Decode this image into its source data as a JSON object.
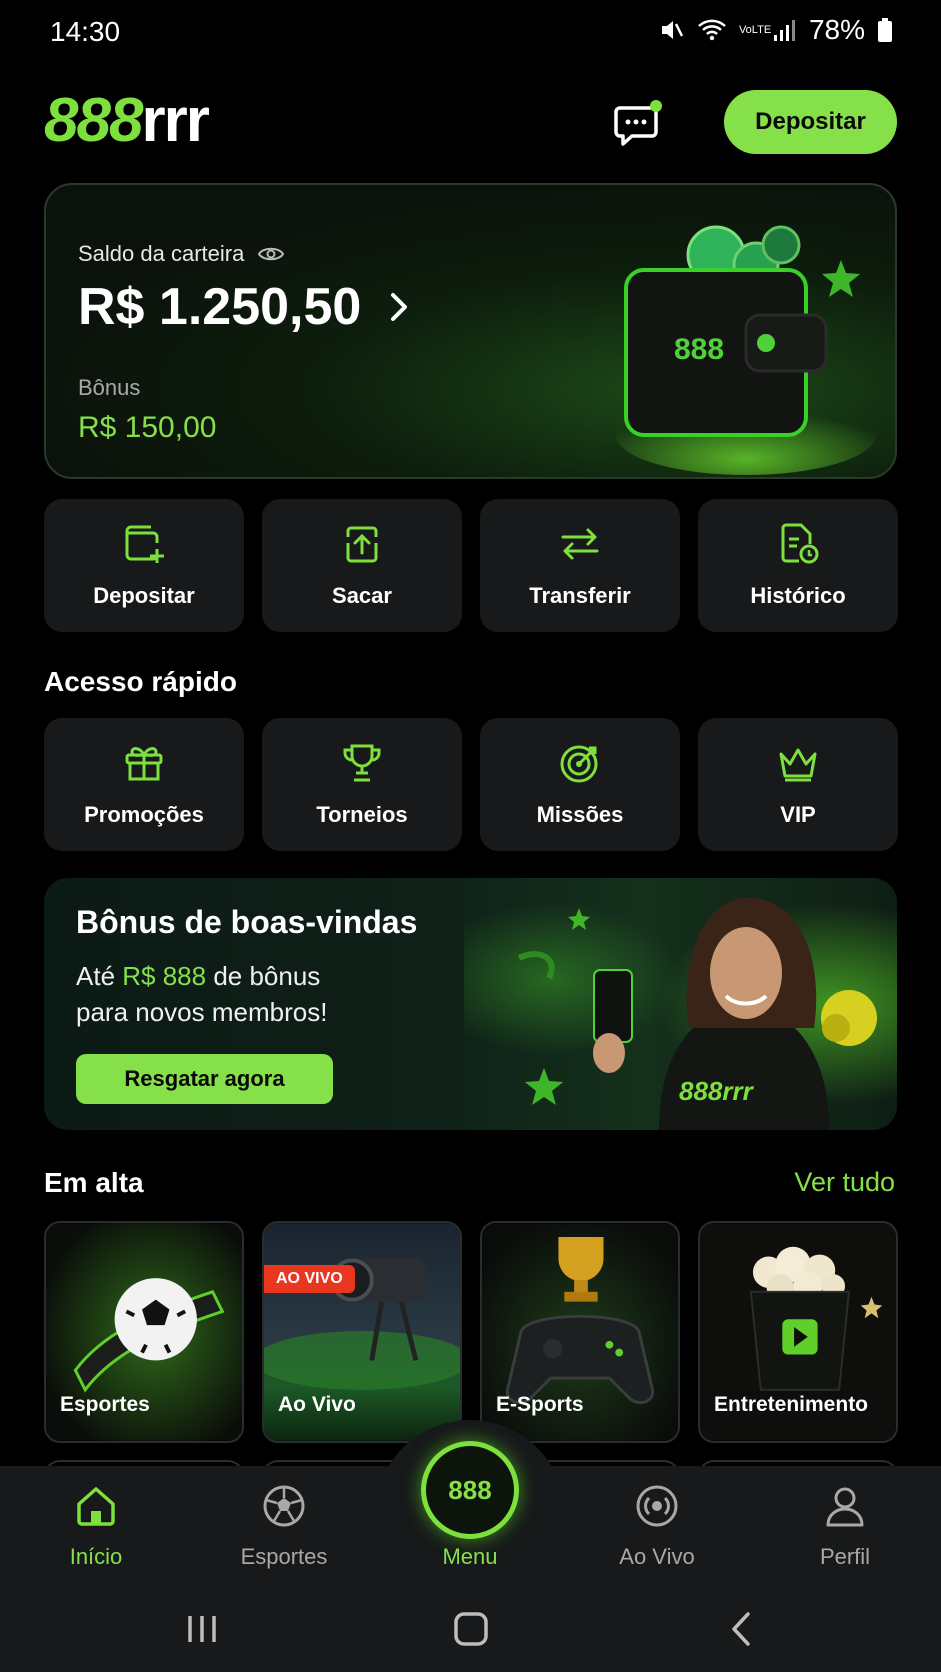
{
  "status_bar": {
    "time": "14:30",
    "battery": "78%",
    "network": "VoLTE"
  },
  "header": {
    "logo_num": "888",
    "logo_text": "rrr",
    "deposit_label": "Depositar"
  },
  "wallet": {
    "balance_label": "Saldo da carteira",
    "balance": "R$ 1.250,50",
    "bonus_label": "Bônus",
    "bonus_value": "R$ 150,00",
    "art_logo": "888"
  },
  "actions": [
    {
      "label": "Depositar",
      "icon": "wallet-plus-icon"
    },
    {
      "label": "Sacar",
      "icon": "upload-icon"
    },
    {
      "label": "Transferir",
      "icon": "transfer-icon"
    },
    {
      "label": "Histórico",
      "icon": "history-icon"
    }
  ],
  "quick_access": {
    "title": "Acesso rápido",
    "items": [
      {
        "label": "Promoções",
        "icon": "gift-icon"
      },
      {
        "label": "Torneios",
        "icon": "trophy-icon"
      },
      {
        "label": "Missões",
        "icon": "target-icon"
      },
      {
        "label": "VIP",
        "icon": "crown-icon"
      }
    ]
  },
  "promo": {
    "title": "Bônus de boas-vindas",
    "line1_prefix": "Até ",
    "line1_highlight": "R$ 888",
    "line1_suffix": " de bônus",
    "line2": "para novos membros!",
    "button": "Resgatar agora",
    "shirt_logo": "888rrr"
  },
  "trending": {
    "title": "Em alta",
    "see_all": "Ver tudo",
    "live_badge": "AO VIVO",
    "cards": [
      {
        "label": "Esportes"
      },
      {
        "label": "Ao Vivo"
      },
      {
        "label": "E-Sports"
      },
      {
        "label": "Entretenimento"
      }
    ]
  },
  "bottom_nav": {
    "items": [
      {
        "label": "Início",
        "icon": "home-icon"
      },
      {
        "label": "Esportes",
        "icon": "soccer-ball-icon"
      },
      {
        "label": "Ao Vivo",
        "icon": "live-broadcast-icon"
      },
      {
        "label": "Perfil",
        "icon": "user-icon"
      }
    ],
    "menu_badge": "888",
    "menu_label": "Menu"
  },
  "colors": {
    "accent": "#86e04a",
    "background": "#000000",
    "tile": "#17191a",
    "live": "#e8361f"
  }
}
